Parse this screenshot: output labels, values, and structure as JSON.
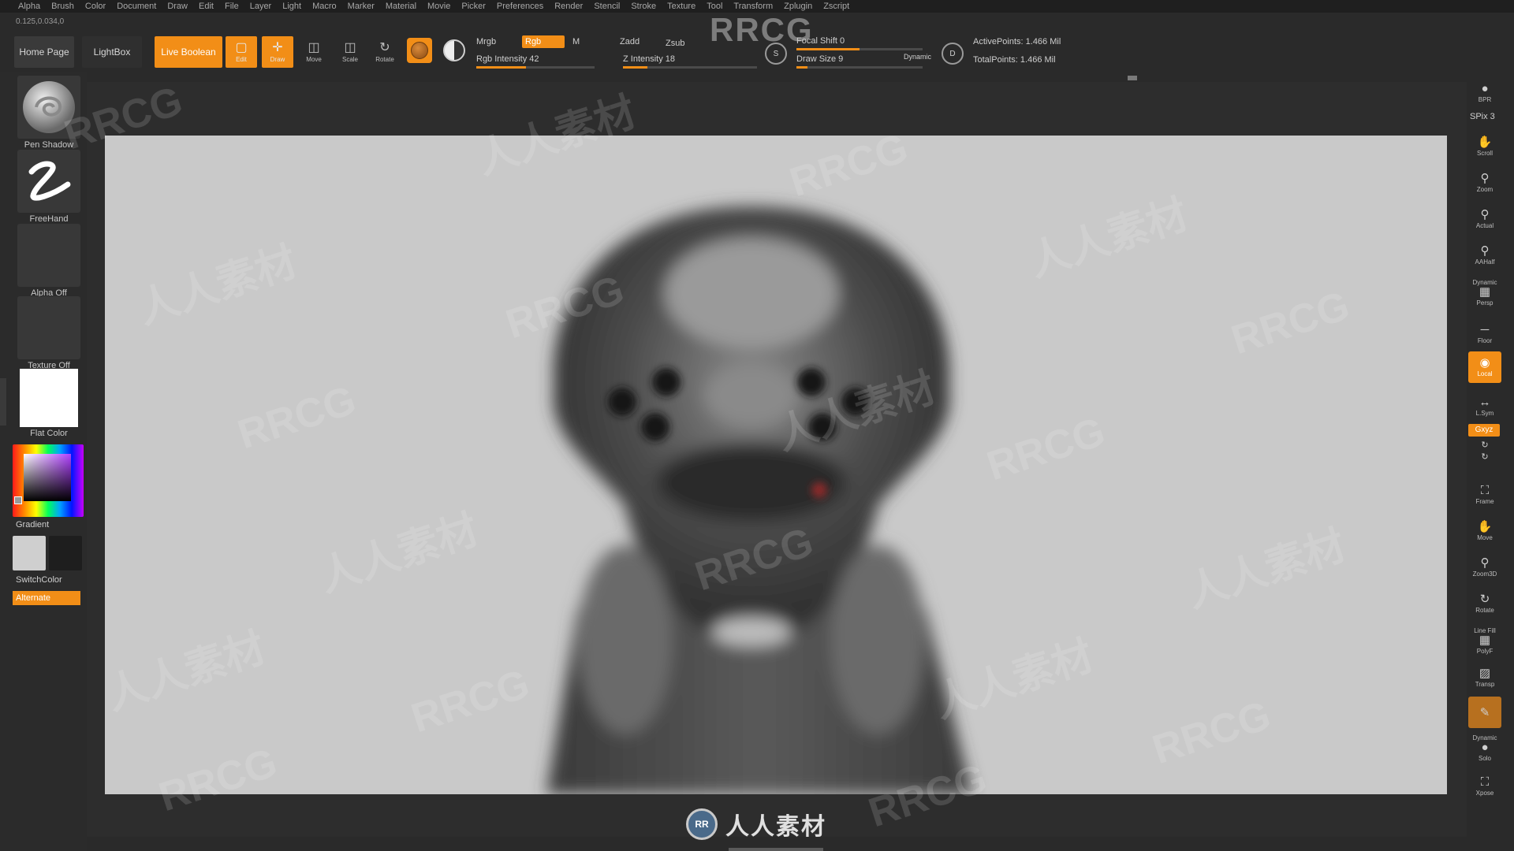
{
  "menu": [
    "Alpha",
    "Brush",
    "Color",
    "Document",
    "Draw",
    "Edit",
    "File",
    "Layer",
    "Light",
    "Macro",
    "Marker",
    "Material",
    "Movie",
    "Picker",
    "Preferences",
    "Render",
    "Stencil",
    "Stroke",
    "Texture",
    "Tool",
    "Transform",
    "Zplugin",
    "Zscript"
  ],
  "coords": "0.125,0.034,0",
  "top": {
    "home": "Home Page",
    "lightbox": "LightBox",
    "live_boolean": "Live Boolean",
    "edit": "Edit",
    "draw": "Draw",
    "move": "Move",
    "scale": "Scale",
    "rotate": "Rotate",
    "mrgb": "Mrgb",
    "rgb": "Rgb",
    "m": "M",
    "zadd": "Zadd",
    "zsub": "Zsub",
    "rgb_intensity": "Rgb Intensity 42",
    "z_intensity": "Z Intensity 18",
    "focal_shift": "Focal Shift 0",
    "draw_size": "Draw Size 9",
    "dynamic": "Dynamic",
    "active_points": "ActivePoints: 1.466 Mil",
    "total_points": "TotalPoints: 1.466 Mil",
    "logo": "RRCG",
    "s": "S",
    "d": "D"
  },
  "left": {
    "pen_shadow": "Pen Shadow",
    "freehand": "FreeHand",
    "alpha_off": "Alpha Off",
    "texture_off": "Texture Off",
    "flat_color": "Flat Color",
    "gradient": "Gradient",
    "switch_color": "SwitchColor",
    "alternate": "Alternate"
  },
  "right": {
    "bpr": "BPR",
    "spix": "SPix 3",
    "scroll": "Scroll",
    "zoom": "Zoom",
    "actual": "Actual",
    "aahalf": "AAHalf",
    "dynamic": "Dynamic",
    "persp": "Persp",
    "floor": "Floor",
    "local": "Local",
    "lsym": "L.Sym",
    "xyz": "Gxyz",
    "frame": "Frame",
    "move": "Move",
    "zoom3d": "Zoom3D",
    "rotate": "Rotate",
    "linefill": "Line Fill",
    "polyf": "PolyF",
    "transp": "Transp",
    "dynamic2": "Dynamic",
    "solo": "Solo",
    "xpose": "Xpose"
  },
  "watermark": {
    "latin": "RRCG",
    "cjk": "人人素材",
    "bottom": "人人素材"
  },
  "colors": {
    "accent": "#f28e17",
    "canvas_bg": "#c9c9c9",
    "ui_bg": "#2a2a2a"
  },
  "sliders": {
    "rgb_intensity": 0.42,
    "z_intensity": 0.18,
    "focal_shift": 0.5,
    "draw_size": 0.09
  }
}
